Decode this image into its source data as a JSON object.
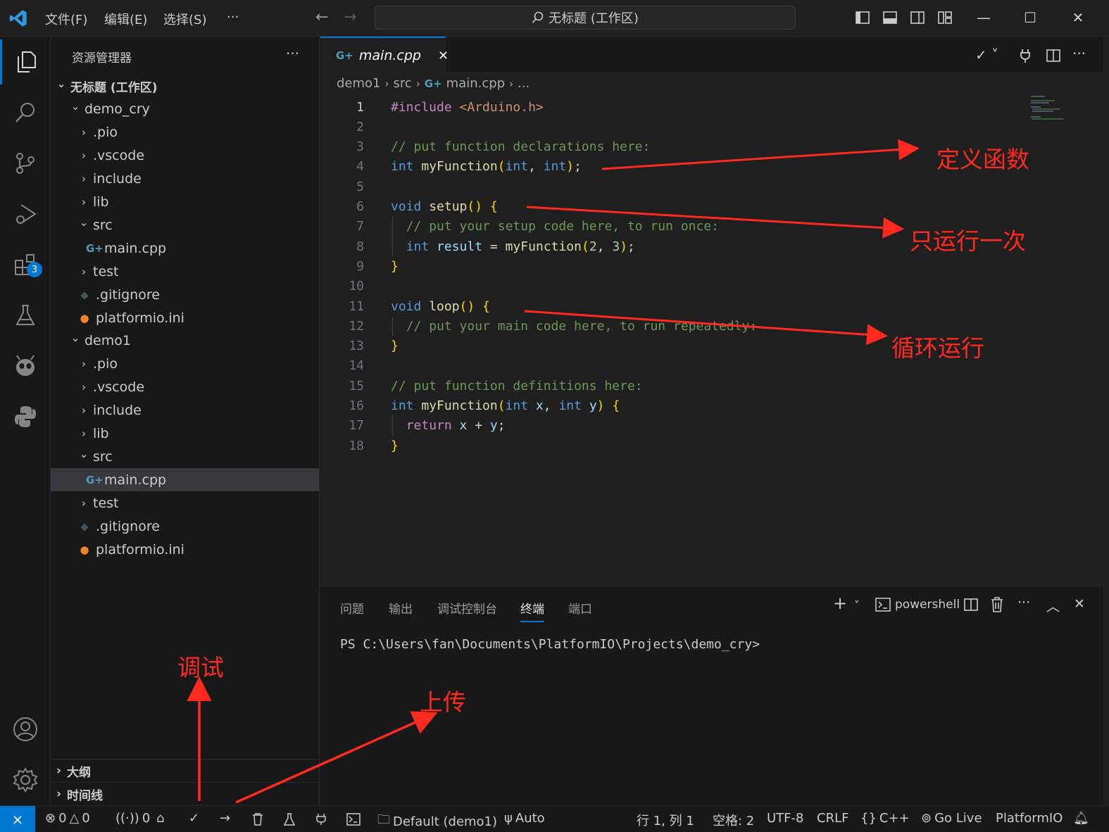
{
  "titlebar": {
    "menus": [
      "文件(F)",
      "编辑(E)",
      "选择(S)",
      "···"
    ],
    "search_text": "无标题 (工作区)"
  },
  "activity": {
    "extensions_badge": "3"
  },
  "sidebar": {
    "title": "资源管理器",
    "more": "···",
    "tree": [
      {
        "label": "无标题 (工作区)",
        "chev": "∨",
        "depth": 0,
        "bold": true
      },
      {
        "label": "demo_cry",
        "chev": "∨",
        "depth": 1
      },
      {
        "label": ".pio",
        "chev": ">",
        "depth": 2
      },
      {
        "label": ".vscode",
        "chev": ">",
        "depth": 2
      },
      {
        "label": "include",
        "chev": ">",
        "depth": 2
      },
      {
        "label": "lib",
        "chev": ">",
        "depth": 2
      },
      {
        "label": "src",
        "chev": "∨",
        "depth": 2
      },
      {
        "label": "main.cpp",
        "chev": "",
        "depth": 3,
        "icon": "cpp"
      },
      {
        "label": "test",
        "chev": ">",
        "depth": 2
      },
      {
        "label": ".gitignore",
        "chev": "",
        "depth": 2,
        "icon": "git"
      },
      {
        "label": "platformio.ini",
        "chev": "",
        "depth": 2,
        "icon": "pio"
      },
      {
        "label": "demo1",
        "chev": "∨",
        "depth": 1
      },
      {
        "label": ".pio",
        "chev": ">",
        "depth": 2
      },
      {
        "label": ".vscode",
        "chev": ">",
        "depth": 2
      },
      {
        "label": "include",
        "chev": ">",
        "depth": 2
      },
      {
        "label": "lib",
        "chev": ">",
        "depth": 2
      },
      {
        "label": "src",
        "chev": "∨",
        "depth": 2
      },
      {
        "label": "main.cpp",
        "chev": "",
        "depth": 3,
        "icon": "cpp",
        "selected": true
      },
      {
        "label": "test",
        "chev": ">",
        "depth": 2
      },
      {
        "label": ".gitignore",
        "chev": "",
        "depth": 2,
        "icon": "git"
      },
      {
        "label": "platformio.ini",
        "chev": "",
        "depth": 2,
        "icon": "pio"
      }
    ],
    "outline": "大纲",
    "timeline": "时间线"
  },
  "editor": {
    "tab_label": "main.cpp",
    "tab_close": "✕",
    "breadcrumb": [
      "demo1",
      "src",
      "main.cpp",
      "..."
    ],
    "lines": [
      {
        "n": "1",
        "tokens": [
          [
            "ctl",
            "#include "
          ],
          [
            "inc",
            "<Arduino.h>"
          ]
        ]
      },
      {
        "n": "2",
        "tokens": []
      },
      {
        "n": "3",
        "tokens": [
          [
            "cm",
            "// put function declarations here:"
          ]
        ]
      },
      {
        "n": "4",
        "tokens": [
          [
            "kw",
            "int "
          ],
          [
            "fn",
            "myFunction"
          ],
          [
            "br",
            "("
          ],
          [
            "kw",
            "int"
          ],
          [
            "txt",
            ", "
          ],
          [
            "kw",
            "int"
          ],
          [
            "br",
            ")"
          ],
          [
            "txt",
            ";"
          ]
        ]
      },
      {
        "n": "5",
        "tokens": []
      },
      {
        "n": "6",
        "tokens": [
          [
            "kw",
            "void "
          ],
          [
            "fn",
            "setup"
          ],
          [
            "br",
            "() {"
          ]
        ]
      },
      {
        "n": "7",
        "tokens": [
          [
            "txt",
            "  "
          ],
          [
            "cm",
            "// put your setup code here, to run once:"
          ]
        ]
      },
      {
        "n": "8",
        "tokens": [
          [
            "txt",
            "  "
          ],
          [
            "kw",
            "int "
          ],
          [
            "var",
            "result"
          ],
          [
            "txt",
            " = "
          ],
          [
            "fn",
            "myFunction"
          ],
          [
            "br",
            "("
          ],
          [
            "num",
            "2"
          ],
          [
            "txt",
            ", "
          ],
          [
            "num",
            "3"
          ],
          [
            "br",
            ")"
          ],
          [
            "txt",
            ";"
          ]
        ]
      },
      {
        "n": "9",
        "tokens": [
          [
            "br",
            "}"
          ]
        ]
      },
      {
        "n": "10",
        "tokens": []
      },
      {
        "n": "11",
        "tokens": [
          [
            "kw",
            "void "
          ],
          [
            "fn",
            "loop"
          ],
          [
            "br",
            "() {"
          ]
        ]
      },
      {
        "n": "12",
        "tokens": [
          [
            "txt",
            "  "
          ],
          [
            "cm",
            "// put your main code here, to run repeatedly:"
          ]
        ]
      },
      {
        "n": "13",
        "tokens": [
          [
            "br",
            "}"
          ]
        ]
      },
      {
        "n": "14",
        "tokens": []
      },
      {
        "n": "15",
        "tokens": [
          [
            "cm",
            "// put function definitions here:"
          ]
        ]
      },
      {
        "n": "16",
        "tokens": [
          [
            "kw",
            "int "
          ],
          [
            "fn",
            "myFunction"
          ],
          [
            "br",
            "("
          ],
          [
            "kw",
            "int "
          ],
          [
            "var",
            "x"
          ],
          [
            "txt",
            ", "
          ],
          [
            "kw",
            "int "
          ],
          [
            "var",
            "y"
          ],
          [
            "br",
            ") {"
          ]
        ]
      },
      {
        "n": "17",
        "tokens": [
          [
            "txt",
            "  "
          ],
          [
            "ctl",
            "return "
          ],
          [
            "var",
            "x"
          ],
          [
            "txt",
            " + "
          ],
          [
            "var",
            "y"
          ],
          [
            "txt",
            ";"
          ]
        ]
      },
      {
        "n": "18",
        "tokens": [
          [
            "br",
            "}"
          ]
        ]
      }
    ]
  },
  "panel": {
    "tabs": [
      "问题",
      "输出",
      "调试控制台",
      "终端",
      "端口"
    ],
    "active_tab": "终端",
    "shell": "powershell",
    "terminal_prompt": "PS C:\\Users\\fan\\Documents\\PlatformIO\\Projects\\demo_cry>"
  },
  "statusbar": {
    "errors": "0",
    "warnings": "0",
    "ports": "0",
    "env": "Default (demo1)",
    "auto": "Auto",
    "position": "行 1, 列 1",
    "spaces": "空格: 2",
    "encoding": "UTF-8",
    "eol": "CRLF",
    "language": "C++",
    "golive": "Go Live",
    "platformio": "PlatformIO"
  },
  "annotations": {
    "define": "定义函数",
    "once": "只运行一次",
    "loop": "循环运行",
    "debug": "调试",
    "upload": "上传"
  },
  "colors": {
    "accent": "#0078d4",
    "annotation": "#ff2a1f",
    "background": "#1f1f1f"
  }
}
